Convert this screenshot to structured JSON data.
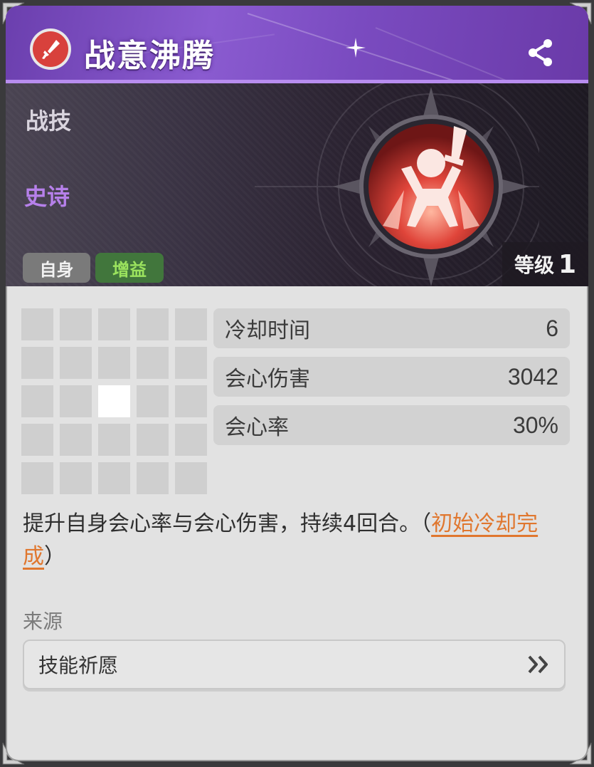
{
  "header": {
    "title": "战意沸腾",
    "skill_icon": "sword-icon",
    "share_icon": "share-icon"
  },
  "banner": {
    "type": "战技",
    "rarity": "史诗",
    "tags": [
      "自身",
      "增益"
    ],
    "level_label": "等级",
    "level_value": "1",
    "skill_art": "raised-sword-figure-icon"
  },
  "range_grid": {
    "rows": 5,
    "cols": 5,
    "active_cells": [
      [
        2,
        2
      ]
    ]
  },
  "stats": [
    {
      "label": "冷却时间",
      "value": "6"
    },
    {
      "label": "会心伤害",
      "value": "3042"
    },
    {
      "label": "会心率",
      "value": "30%"
    }
  ],
  "description": {
    "text": "提升自身会心率与会心伤害，持续4回合。（",
    "highlight": "初始冷却完成",
    "close": "）"
  },
  "source": {
    "label": "来源",
    "button_text": "技能祈愿",
    "button_icon": "double-chevron-right-icon"
  },
  "colors": {
    "header_purple": "#7a4bc0",
    "rarity_epic": "#b680ea",
    "buff_green": "#9be35e",
    "highlight_orange": "#e0772f"
  }
}
